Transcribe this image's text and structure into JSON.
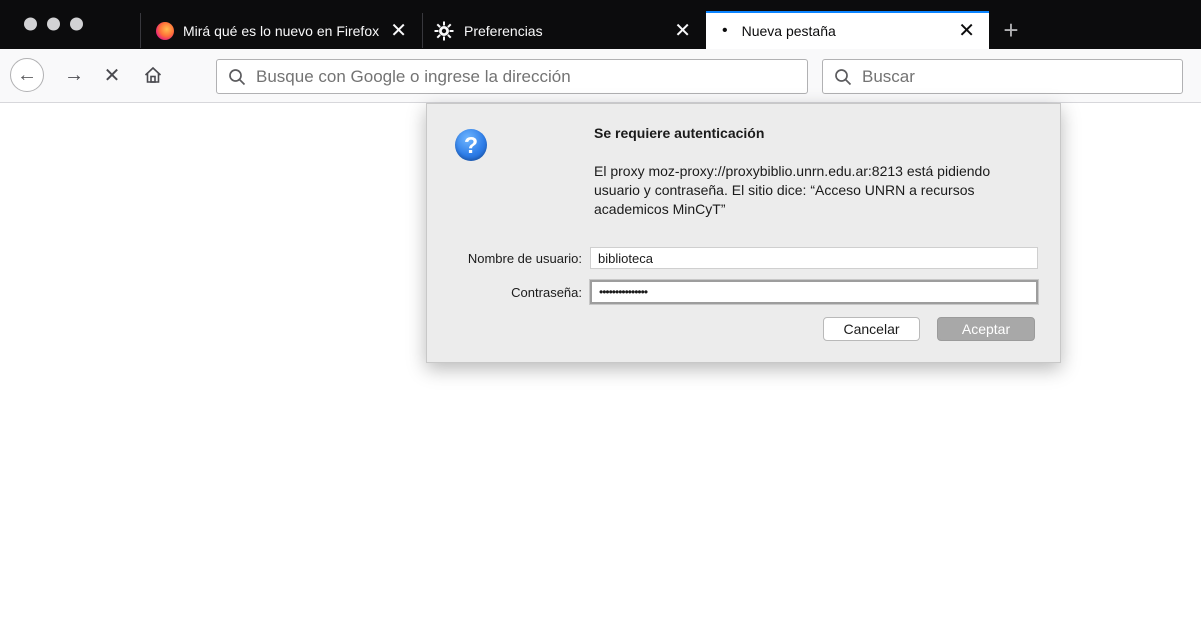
{
  "tabs": [
    {
      "label": "Mirá qué es lo nuevo en Firefox",
      "icon": "firefox-icon"
    },
    {
      "label": "Preferencias",
      "icon": "gear-icon"
    },
    {
      "label": "Nueva pestaña",
      "icon": "dot-icon",
      "selected": true
    }
  ],
  "toolbar": {
    "url_placeholder": "Busque con Google o ingrese la dirección",
    "search_placeholder": "Buscar"
  },
  "dialog": {
    "title": "Se requiere autenticación",
    "message": "El proxy moz-proxy://proxybiblio.unrn.edu.ar:8213 está pidiendo usuario y contraseña. El sitio dice: “Acceso UNRN a recursos academicos MinCyT”",
    "username_label": "Nombre de usuario:",
    "username_value": "biblioteca",
    "password_label": "Contraseña:",
    "password_value": "•••••••••••••••",
    "cancel_label": "Cancelar",
    "ok_label": "Aceptar",
    "icon": "question-icon"
  },
  "colors": {
    "tab_accent": "#0a84ff",
    "ok_button": "#a8a8a8"
  }
}
